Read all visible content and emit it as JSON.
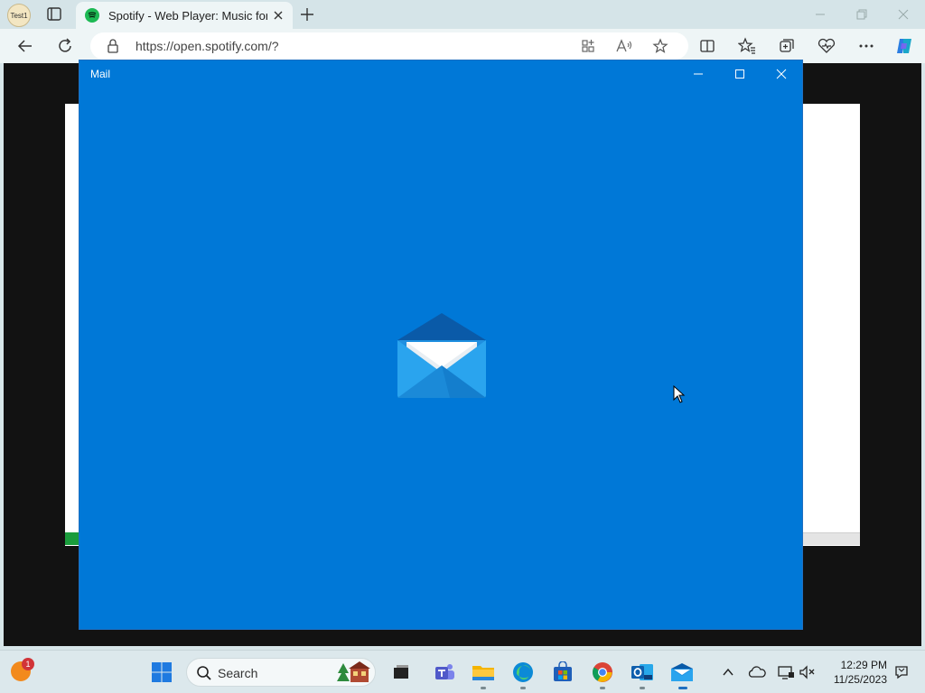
{
  "browser": {
    "profile_label": "Test1",
    "tab_title": "Spotify - Web Player: Music for everyone",
    "url": "https://open.spotify.com/?"
  },
  "mail_window": {
    "title": "Mail"
  },
  "taskbar": {
    "weather_badge": "1",
    "search_label": "Search",
    "time": "12:29 PM",
    "date": "11/25/2023",
    "apps": [
      "windows-start",
      "task-view",
      "teams",
      "file-explorer",
      "edge",
      "microsoft-store",
      "chrome",
      "outlook",
      "mail"
    ]
  },
  "colors": {
    "mail_blue": "#0078d7",
    "spotify_green": "#1db954"
  }
}
